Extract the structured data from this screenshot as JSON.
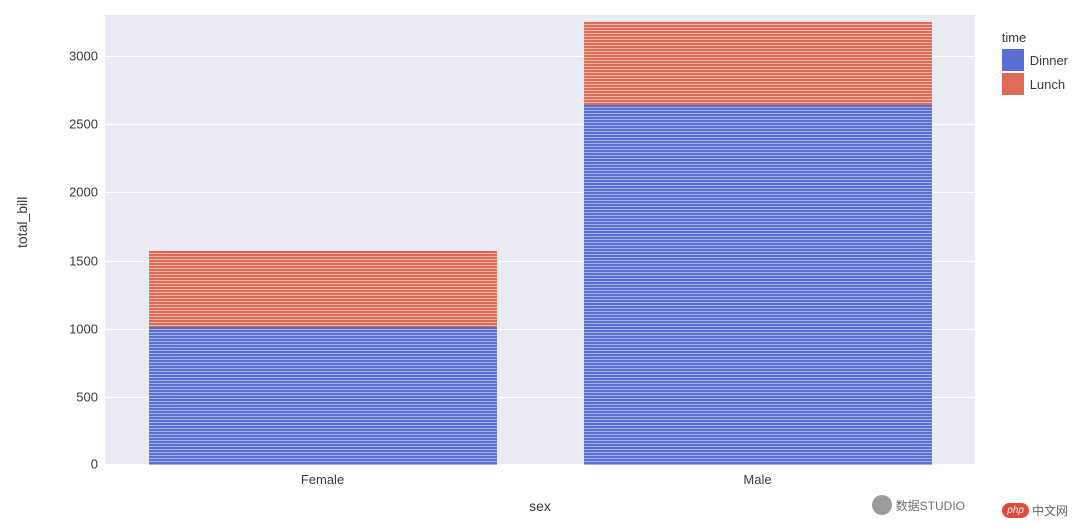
{
  "chart_data": {
    "type": "bar",
    "stacked": true,
    "categories": [
      "Female",
      "Male"
    ],
    "series": [
      {
        "name": "Dinner",
        "values": [
          1010,
          2640
        ],
        "color": "#5a6fd3"
      },
      {
        "name": "Lunch",
        "values": [
          560,
          610
        ],
        "color": "#dd6b55"
      }
    ],
    "totals": [
      1570,
      3250
    ],
    "title": "",
    "xlabel": "sex",
    "ylabel": "total_bill",
    "ylim": [
      0,
      3300
    ],
    "yticks": [
      0,
      500,
      1000,
      1500,
      2000,
      2500,
      3000
    ],
    "legend_title": "time",
    "legend_position": "upper right"
  },
  "legend": {
    "title": "time",
    "items": [
      {
        "label": "Dinner"
      },
      {
        "label": "Lunch"
      }
    ]
  },
  "axes": {
    "xlabel": "sex",
    "ylabel": "total_bill",
    "xtick0": "Female",
    "xtick1": "Male",
    "ytick0": "0",
    "ytick1": "500",
    "ytick2": "1000",
    "ytick3": "1500",
    "ytick4": "2000",
    "ytick5": "2500",
    "ytick6": "3000"
  },
  "watermark": {
    "left": "数据STUDIO",
    "right": "中文网",
    "php": "php"
  }
}
